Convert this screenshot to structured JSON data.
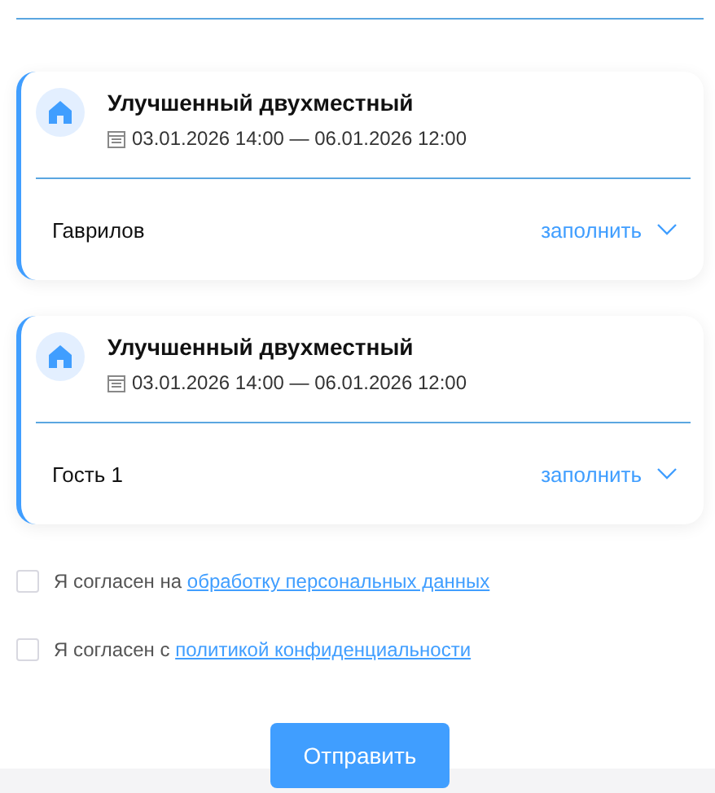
{
  "rooms": [
    {
      "title": "Улучшенный двухместный",
      "dates": "03.01.2026 14:00 — 06.01.2026 12:00",
      "guest": "Гаврилов",
      "action": "заполнить",
      "expanded": false
    },
    {
      "title": "Улучшенный двухместный",
      "dates": "03.01.2026 14:00 — 06.01.2026 12:00",
      "guest": "Гость 1",
      "action": "заполнить",
      "expanded": false
    }
  ],
  "consents": [
    {
      "text": "Я согласен на",
      "link": "обработку персональных данных",
      "checked": false
    },
    {
      "text": "Я согласен с",
      "link": "политикой конфиденциальности",
      "checked": false
    }
  ],
  "submit": "Отправить"
}
